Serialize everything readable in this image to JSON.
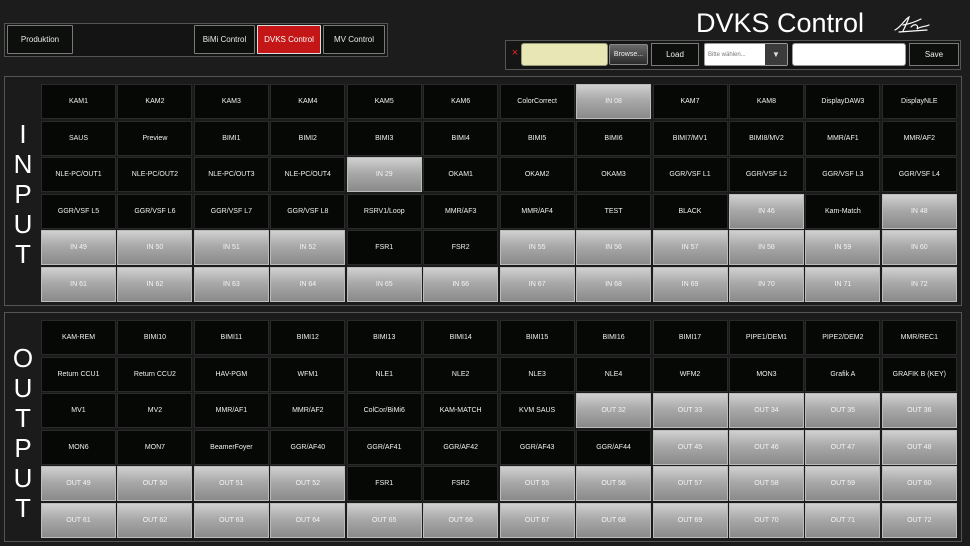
{
  "header": {
    "title": "DVKS Control",
    "nav": {
      "produktion": "Produktion",
      "bimi": "BiMi Control",
      "dvks": "DVKS Control",
      "mv": "MV Control"
    },
    "active_nav": "dvks",
    "active_color": "#c41616"
  },
  "toolbar": {
    "clear_symbol": "×",
    "browse_label": "Browse...",
    "load_label": "Load",
    "select_value": "Bitte wählen...",
    "save_label": "Save"
  },
  "sections": {
    "input": {
      "label": "INPUT",
      "cells": [
        {
          "label": "KAM1",
          "style": "dark"
        },
        {
          "label": "KAM2",
          "style": "dark"
        },
        {
          "label": "KAM3",
          "style": "dark"
        },
        {
          "label": "KAM4",
          "style": "dark"
        },
        {
          "label": "KAM5",
          "style": "dark"
        },
        {
          "label": "KAM6",
          "style": "dark"
        },
        {
          "label": "ColorCorrect",
          "style": "dark"
        },
        {
          "label": "IN 08",
          "style": "light"
        },
        {
          "label": "KAM7",
          "style": "dark"
        },
        {
          "label": "KAM8",
          "style": "dark"
        },
        {
          "label": "DisplayDAW3",
          "style": "dark"
        },
        {
          "label": "DisplayNLE",
          "style": "dark"
        },
        {
          "label": "SAUS",
          "style": "dark"
        },
        {
          "label": "Preview",
          "style": "dark"
        },
        {
          "label": "BIMI1",
          "style": "dark"
        },
        {
          "label": "BIMI2",
          "style": "dark"
        },
        {
          "label": "BIMI3",
          "style": "dark"
        },
        {
          "label": "BIMI4",
          "style": "dark"
        },
        {
          "label": "BIMI5",
          "style": "dark"
        },
        {
          "label": "BIMI6",
          "style": "dark"
        },
        {
          "label": "BIMI7/MV1",
          "style": "dark"
        },
        {
          "label": "BIMI8/MV2",
          "style": "dark"
        },
        {
          "label": "MMR/AF1",
          "style": "dark"
        },
        {
          "label": "MMR/AF2",
          "style": "dark"
        },
        {
          "label": "NLE-PC/OUT1",
          "style": "dark"
        },
        {
          "label": "NLE-PC/OUT2",
          "style": "dark"
        },
        {
          "label": "NLE-PC/OUT3",
          "style": "dark"
        },
        {
          "label": "NLE-PC/OUT4",
          "style": "dark"
        },
        {
          "label": "IN 29",
          "style": "light"
        },
        {
          "label": "OKAM1",
          "style": "dark"
        },
        {
          "label": "OKAM2",
          "style": "dark"
        },
        {
          "label": "OKAM3",
          "style": "dark"
        },
        {
          "label": "GGR/VSF L1",
          "style": "dark"
        },
        {
          "label": "GGR/VSF L2",
          "style": "dark"
        },
        {
          "label": "GGR/VSF L3",
          "style": "dark"
        },
        {
          "label": "GGR/VSF L4",
          "style": "dark"
        },
        {
          "label": "GGR/VSF L5",
          "style": "dark"
        },
        {
          "label": "GGR/VSF L6",
          "style": "dark"
        },
        {
          "label": "GGR/VSF L7",
          "style": "dark"
        },
        {
          "label": "GGR/VSF L8",
          "style": "dark"
        },
        {
          "label": "RSRV1/Loop",
          "style": "dark"
        },
        {
          "label": "MMR/AF3",
          "style": "dark"
        },
        {
          "label": "MMR/AF4",
          "style": "dark"
        },
        {
          "label": "TEST",
          "style": "dark"
        },
        {
          "label": "BLACK",
          "style": "dark"
        },
        {
          "label": "IN 46",
          "style": "light"
        },
        {
          "label": "Kam-Match",
          "style": "dark"
        },
        {
          "label": "IN 48",
          "style": "light"
        },
        {
          "label": "IN 49",
          "style": "light"
        },
        {
          "label": "IN 50",
          "style": "light"
        },
        {
          "label": "IN 51",
          "style": "light"
        },
        {
          "label": "IN 52",
          "style": "light"
        },
        {
          "label": "FSR1",
          "style": "dark"
        },
        {
          "label": "FSR2",
          "style": "dark"
        },
        {
          "label": "IN 55",
          "style": "light"
        },
        {
          "label": "IN 56",
          "style": "light"
        },
        {
          "label": "IN 57",
          "style": "light"
        },
        {
          "label": "IN 58",
          "style": "light"
        },
        {
          "label": "IN 59",
          "style": "light"
        },
        {
          "label": "IN 60",
          "style": "light"
        },
        {
          "label": "IN 61",
          "style": "light"
        },
        {
          "label": "IN 62",
          "style": "light"
        },
        {
          "label": "IN 63",
          "style": "light"
        },
        {
          "label": "IN 64",
          "style": "light"
        },
        {
          "label": "IN 65",
          "style": "light"
        },
        {
          "label": "IN 66",
          "style": "light"
        },
        {
          "label": "IN 67",
          "style": "light"
        },
        {
          "label": "IN 68",
          "style": "light"
        },
        {
          "label": "IN 69",
          "style": "light"
        },
        {
          "label": "IN 70",
          "style": "light"
        },
        {
          "label": "IN 71",
          "style": "light"
        },
        {
          "label": "IN 72",
          "style": "light"
        }
      ]
    },
    "output": {
      "label": "OUTPUT",
      "cells": [
        {
          "label": "KAM-REM",
          "style": "dark"
        },
        {
          "label": "BIMI10",
          "style": "dark"
        },
        {
          "label": "BIMI11",
          "style": "dark"
        },
        {
          "label": "BIMI12",
          "style": "dark"
        },
        {
          "label": "BIMI13",
          "style": "dark"
        },
        {
          "label": "BIMI14",
          "style": "dark"
        },
        {
          "label": "BIMI15",
          "style": "dark"
        },
        {
          "label": "BIMI16",
          "style": "dark"
        },
        {
          "label": "BIMI17",
          "style": "dark"
        },
        {
          "label": "PIPE1/DEM1",
          "style": "dark"
        },
        {
          "label": "PIPE2/DEM2",
          "style": "dark"
        },
        {
          "label": "MMR/REC1",
          "style": "dark"
        },
        {
          "label": "Return CCU1",
          "style": "dark"
        },
        {
          "label": "Return CCU2",
          "style": "dark"
        },
        {
          "label": "HAV-PGM",
          "style": "dark"
        },
        {
          "label": "WFM1",
          "style": "dark"
        },
        {
          "label": "NLE1",
          "style": "dark"
        },
        {
          "label": "NLE2",
          "style": "dark"
        },
        {
          "label": "NLE3",
          "style": "dark"
        },
        {
          "label": "NLE4",
          "style": "dark"
        },
        {
          "label": "WFM2",
          "style": "dark"
        },
        {
          "label": "MON3",
          "style": "dark"
        },
        {
          "label": "Grafik A",
          "style": "dark"
        },
        {
          "label": "GRAFIK B (KEY)",
          "style": "dark"
        },
        {
          "label": "MV1",
          "style": "dark"
        },
        {
          "label": "MV2",
          "style": "dark"
        },
        {
          "label": "MMR/AF1",
          "style": "dark"
        },
        {
          "label": "MMR/AF2",
          "style": "dark"
        },
        {
          "label": "ColCor/BiMi6",
          "style": "dark"
        },
        {
          "label": "KAM-MATCH",
          "style": "dark"
        },
        {
          "label": "KVM SAUS",
          "style": "dark"
        },
        {
          "label": "OUT 32",
          "style": "light"
        },
        {
          "label": "OUT 33",
          "style": "light"
        },
        {
          "label": "OUT 34",
          "style": "light"
        },
        {
          "label": "OUT 35",
          "style": "light"
        },
        {
          "label": "OUT 36",
          "style": "light"
        },
        {
          "label": "MON6",
          "style": "dark"
        },
        {
          "label": "MON7",
          "style": "dark"
        },
        {
          "label": "BeamerFoyer",
          "style": "dark"
        },
        {
          "label": "GGR/AF40",
          "style": "dark"
        },
        {
          "label": "GGR/AF41",
          "style": "dark"
        },
        {
          "label": "GGR/AF42",
          "style": "dark"
        },
        {
          "label": "GGR/AF43",
          "style": "dark"
        },
        {
          "label": "GGR/AF44",
          "style": "dark"
        },
        {
          "label": "OUT 45",
          "style": "light"
        },
        {
          "label": "OUT 46",
          "style": "light"
        },
        {
          "label": "OUT 47",
          "style": "light"
        },
        {
          "label": "OUT 48",
          "style": "light"
        },
        {
          "label": "OUT 49",
          "style": "light"
        },
        {
          "label": "OUT 50",
          "style": "light"
        },
        {
          "label": "OUT 51",
          "style": "light"
        },
        {
          "label": "OUT 52",
          "style": "light"
        },
        {
          "label": "FSR1",
          "style": "dark"
        },
        {
          "label": "FSR2",
          "style": "dark"
        },
        {
          "label": "OUT 55",
          "style": "light"
        },
        {
          "label": "OUT 56",
          "style": "light"
        },
        {
          "label": "OUT 57",
          "style": "light"
        },
        {
          "label": "OUT 58",
          "style": "light"
        },
        {
          "label": "OUT 59",
          "style": "light"
        },
        {
          "label": "OUT 60",
          "style": "light"
        },
        {
          "label": "OUT 61",
          "style": "light"
        },
        {
          "label": "OUT 62",
          "style": "light"
        },
        {
          "label": "OUT 63",
          "style": "light"
        },
        {
          "label": "OUT 64",
          "style": "light"
        },
        {
          "label": "OUT 65",
          "style": "light"
        },
        {
          "label": "OUT 66",
          "style": "light"
        },
        {
          "label": "OUT 67",
          "style": "light"
        },
        {
          "label": "OUT 68",
          "style": "light"
        },
        {
          "label": "OUT 69",
          "style": "light"
        },
        {
          "label": "OUT 70",
          "style": "light"
        },
        {
          "label": "OUT 71",
          "style": "light"
        },
        {
          "label": "OUT 72",
          "style": "light"
        }
      ]
    }
  },
  "icons": {
    "clear": "close-icon",
    "dropdown": "chevron-down-icon",
    "logo": "signature-logo-icon"
  }
}
